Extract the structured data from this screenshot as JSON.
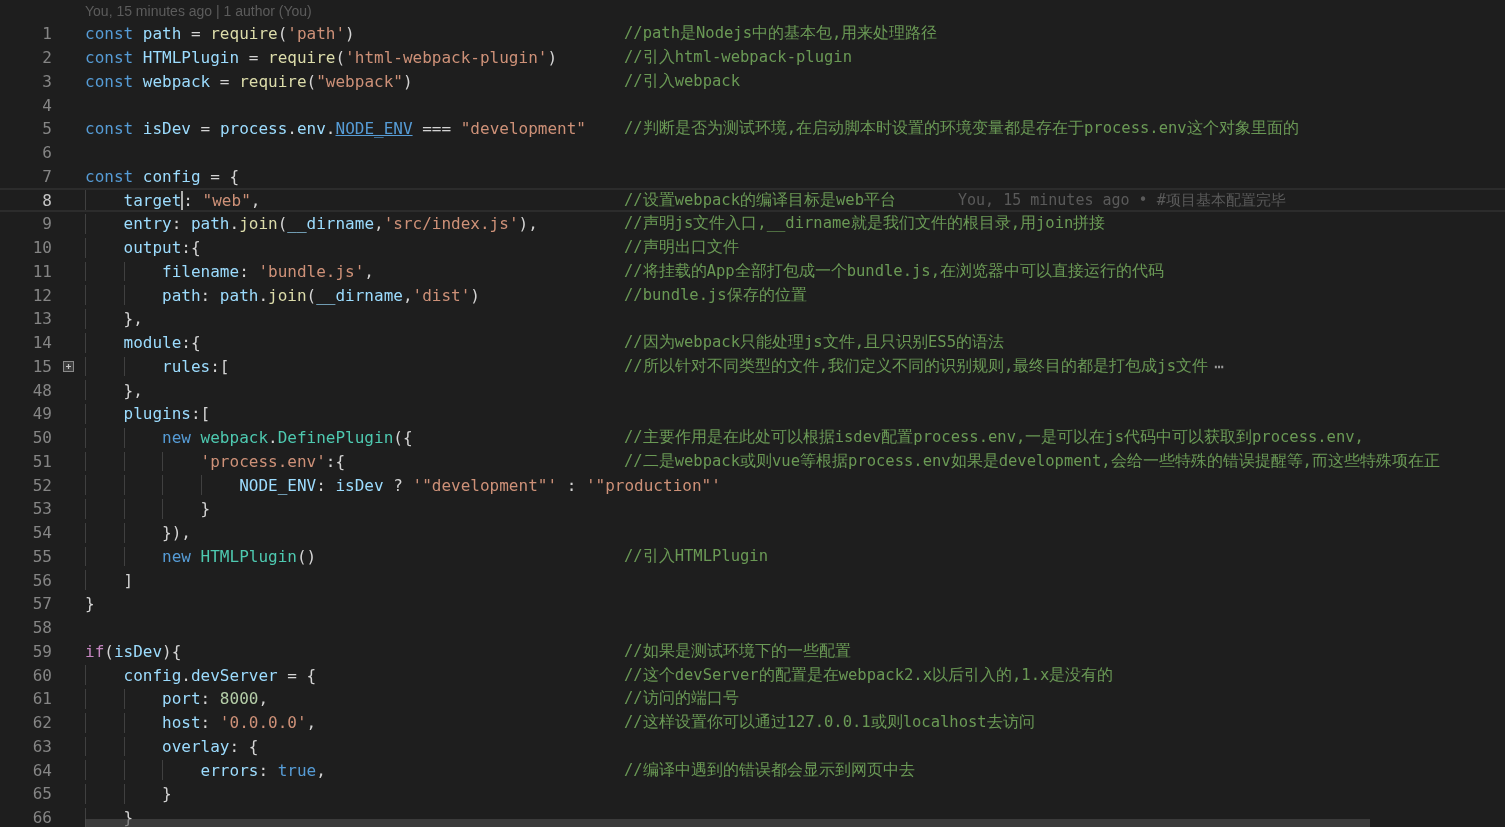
{
  "codelens": "You, 15 minutes ago | 1 author (You)",
  "lines": [
    {
      "number": "1",
      "current": false,
      "folded": false,
      "code": [
        {
          "text": "const ",
          "kind": "keyword"
        },
        {
          "text": "path",
          "kind": "variable"
        },
        {
          "text": " = ",
          "kind": "plain"
        },
        {
          "text": "require",
          "kind": "function"
        },
        {
          "text": "(",
          "kind": "plain"
        },
        {
          "text": "'path'",
          "kind": "string"
        },
        {
          "text": ")",
          "kind": "plain"
        }
      ],
      "comment": "//path是Nodejs中的基本包,用来处理路径"
    },
    {
      "number": "2",
      "current": false,
      "folded": false,
      "code": [
        {
          "text": "const ",
          "kind": "keyword"
        },
        {
          "text": "HTMLPlugin",
          "kind": "variable"
        },
        {
          "text": " = ",
          "kind": "plain"
        },
        {
          "text": "require",
          "kind": "function"
        },
        {
          "text": "(",
          "kind": "plain"
        },
        {
          "text": "'html-webpack-plugin'",
          "kind": "string"
        },
        {
          "text": ")",
          "kind": "plain"
        }
      ],
      "comment": "//引入html-webpack-plugin"
    },
    {
      "number": "3",
      "current": false,
      "folded": false,
      "code": [
        {
          "text": "const ",
          "kind": "keyword"
        },
        {
          "text": "webpack",
          "kind": "variable"
        },
        {
          "text": " = ",
          "kind": "plain"
        },
        {
          "text": "require",
          "kind": "function"
        },
        {
          "text": "(",
          "kind": "plain"
        },
        {
          "text": "\"webpack\"",
          "kind": "string"
        },
        {
          "text": ")",
          "kind": "plain"
        }
      ],
      "comment": "//引入webpack"
    },
    {
      "number": "4",
      "current": false,
      "folded": false
    },
    {
      "number": "5",
      "current": false,
      "folded": false,
      "code": [
        {
          "text": "const ",
          "kind": "keyword"
        },
        {
          "text": "isDev",
          "kind": "variable"
        },
        {
          "text": " = ",
          "kind": "plain"
        },
        {
          "text": "process",
          "kind": "variable"
        },
        {
          "text": ".",
          "kind": "plain"
        },
        {
          "text": "env",
          "kind": "variable"
        },
        {
          "text": ".",
          "kind": "plain"
        },
        {
          "text": "NODE_ENV",
          "kind": "link"
        },
        {
          "text": " === ",
          "kind": "plain"
        },
        {
          "text": "\"development\"",
          "kind": "string"
        }
      ],
      "comment": "//判断是否为测试环境,在启动脚本时设置的环境变量都是存在于process.env这个对象里面的"
    },
    {
      "number": "6",
      "current": false,
      "folded": false
    },
    {
      "number": "7",
      "current": false,
      "folded": false,
      "code": [
        {
          "text": "const ",
          "kind": "keyword"
        },
        {
          "text": "config",
          "kind": "variable"
        },
        {
          "text": " = {",
          "kind": "plain"
        }
      ]
    },
    {
      "number": "8",
      "current": true,
      "folded": false,
      "code": [
        {
          "text": "    target",
          "kind": "variable",
          "cursor": true
        },
        {
          "text": ": ",
          "kind": "plain"
        },
        {
          "text": "\"web\"",
          "kind": "string"
        },
        {
          "text": ",",
          "kind": "plain"
        }
      ],
      "comment": "//设置webpack的编译目标是web平台",
      "blame": "You, 15 minutes ago • #项目基本配置完毕"
    },
    {
      "number": "9",
      "current": false,
      "folded": false,
      "code": [
        {
          "text": "    entry",
          "kind": "variable"
        },
        {
          "text": ": ",
          "kind": "plain"
        },
        {
          "text": "path",
          "kind": "variable"
        },
        {
          "text": ".",
          "kind": "plain"
        },
        {
          "text": "join",
          "kind": "function"
        },
        {
          "text": "(",
          "kind": "plain"
        },
        {
          "text": "__dirname",
          "kind": "variable"
        },
        {
          "text": ",",
          "kind": "plain"
        },
        {
          "text": "'src/index.js'",
          "kind": "string"
        },
        {
          "text": "),",
          "kind": "plain"
        }
      ],
      "comment": "//声明js文件入口,__dirname就是我们文件的根目录,用join拼接"
    },
    {
      "number": "10",
      "current": false,
      "folded": false,
      "code": [
        {
          "text": "    output",
          "kind": "variable"
        },
        {
          "text": ":{",
          "kind": "plain"
        }
      ],
      "comment": "//声明出口文件"
    },
    {
      "number": "11",
      "current": false,
      "folded": false,
      "code": [
        {
          "text": "        filename",
          "kind": "variable"
        },
        {
          "text": ": ",
          "kind": "plain"
        },
        {
          "text": "'bundle.js'",
          "kind": "string"
        },
        {
          "text": ",",
          "kind": "plain"
        }
      ],
      "comment": "//将挂载的App全部打包成一个bundle.js,在浏览器中可以直接运行的代码"
    },
    {
      "number": "12",
      "current": false,
      "folded": false,
      "code": [
        {
          "text": "        path",
          "kind": "variable"
        },
        {
          "text": ": ",
          "kind": "plain"
        },
        {
          "text": "path",
          "kind": "variable"
        },
        {
          "text": ".",
          "kind": "plain"
        },
        {
          "text": "join",
          "kind": "function"
        },
        {
          "text": "(",
          "kind": "plain"
        },
        {
          "text": "__dirname",
          "kind": "variable"
        },
        {
          "text": ",",
          "kind": "plain"
        },
        {
          "text": "'dist'",
          "kind": "string"
        },
        {
          "text": ")",
          "kind": "plain"
        }
      ],
      "comment": "//bundle.js保存的位置"
    },
    {
      "number": "13",
      "current": false,
      "folded": false,
      "code": [
        {
          "text": "    },",
          "kind": "plain"
        }
      ]
    },
    {
      "number": "14",
      "current": false,
      "folded": false,
      "code": [
        {
          "text": "    module",
          "kind": "variable"
        },
        {
          "text": ":{",
          "kind": "plain"
        }
      ],
      "comment": "//因为webpack只能处理js文件,且只识别ES5的语法"
    },
    {
      "number": "15",
      "current": false,
      "folded": true,
      "code": [
        {
          "text": "        rules",
          "kind": "variable"
        },
        {
          "text": ":[",
          "kind": "plain"
        }
      ],
      "comment": "//所以针对不同类型的文件,我们定义不同的识别规则,最终目的都是打包成js文件",
      "fold_ellipsis": "⋯"
    },
    {
      "number": "48",
      "current": false,
      "folded": false,
      "code": [
        {
          "text": "    },",
          "kind": "plain"
        }
      ]
    },
    {
      "number": "49",
      "current": false,
      "folded": false,
      "code": [
        {
          "text": "    plugins",
          "kind": "variable"
        },
        {
          "text": ":[",
          "kind": "plain"
        }
      ]
    },
    {
      "number": "50",
      "current": false,
      "folded": false,
      "code": [
        {
          "text": "        new ",
          "kind": "keyword"
        },
        {
          "text": "webpack",
          "kind": "class"
        },
        {
          "text": ".",
          "kind": "plain"
        },
        {
          "text": "DefinePlugin",
          "kind": "class"
        },
        {
          "text": "({",
          "kind": "plain"
        }
      ],
      "comment": "//主要作用是在此处可以根据isdev配置process.env,一是可以在js代码中可以获取到process.env,"
    },
    {
      "number": "51",
      "current": false,
      "folded": false,
      "code": [
        {
          "text": "            'process.env'",
          "kind": "string"
        },
        {
          "text": ":{",
          "kind": "plain"
        }
      ],
      "comment": "//二是webpack或则vue等根据process.env如果是development,会给一些特殊的错误提醒等,而这些特殊项在正"
    },
    {
      "number": "52",
      "current": false,
      "folded": false,
      "code": [
        {
          "text": "                NODE_ENV",
          "kind": "variable"
        },
        {
          "text": ": ",
          "kind": "plain"
        },
        {
          "text": "isDev",
          "kind": "variable"
        },
        {
          "text": " ? ",
          "kind": "plain"
        },
        {
          "text": "'\"development\"'",
          "kind": "string"
        },
        {
          "text": " : ",
          "kind": "plain"
        },
        {
          "text": "'\"production\"'",
          "kind": "string"
        }
      ]
    },
    {
      "number": "53",
      "current": false,
      "folded": false,
      "code": [
        {
          "text": "            }",
          "kind": "plain"
        }
      ]
    },
    {
      "number": "54",
      "current": false,
      "folded": false,
      "code": [
        {
          "text": "        }),",
          "kind": "plain"
        }
      ]
    },
    {
      "number": "55",
      "current": false,
      "folded": false,
      "code": [
        {
          "text": "        new ",
          "kind": "keyword"
        },
        {
          "text": "HTMLPlugin",
          "kind": "class"
        },
        {
          "text": "()",
          "kind": "plain"
        }
      ],
      "comment": "//引入HTMLPlugin"
    },
    {
      "number": "56",
      "current": false,
      "folded": false,
      "code": [
        {
          "text": "    ]",
          "kind": "plain"
        }
      ]
    },
    {
      "number": "57",
      "current": false,
      "folded": false,
      "code": [
        {
          "text": "}",
          "kind": "plain"
        }
      ]
    },
    {
      "number": "58",
      "current": false,
      "folded": false
    },
    {
      "number": "59",
      "current": false,
      "folded": false,
      "code": [
        {
          "text": "if",
          "kind": "control"
        },
        {
          "text": "(",
          "kind": "plain"
        },
        {
          "text": "isDev",
          "kind": "variable"
        },
        {
          "text": "){",
          "kind": "plain"
        }
      ],
      "comment": "//如果是测试环境下的一些配置"
    },
    {
      "number": "60",
      "current": false,
      "folded": false,
      "code": [
        {
          "text": "    config",
          "kind": "variable"
        },
        {
          "text": ".",
          "kind": "plain"
        },
        {
          "text": "devServer",
          "kind": "variable"
        },
        {
          "text": " = {",
          "kind": "plain"
        }
      ],
      "comment": "//这个devServer的配置是在webpack2.x以后引入的,1.x是没有的"
    },
    {
      "number": "61",
      "current": false,
      "folded": false,
      "code": [
        {
          "text": "        port",
          "kind": "variable"
        },
        {
          "text": ": ",
          "kind": "plain"
        },
        {
          "text": "8000",
          "kind": "number"
        },
        {
          "text": ",",
          "kind": "plain"
        }
      ],
      "comment": "//访问的端口号"
    },
    {
      "number": "62",
      "current": false,
      "folded": false,
      "code": [
        {
          "text": "        host",
          "kind": "variable"
        },
        {
          "text": ": ",
          "kind": "plain"
        },
        {
          "text": "'0.0.0.0'",
          "kind": "string"
        },
        {
          "text": ",",
          "kind": "plain"
        }
      ],
      "comment": "//这样设置你可以通过127.0.0.1或则localhost去访问"
    },
    {
      "number": "63",
      "current": false,
      "folded": false,
      "code": [
        {
          "text": "        overlay",
          "kind": "variable"
        },
        {
          "text": ": {",
          "kind": "plain"
        }
      ]
    },
    {
      "number": "64",
      "current": false,
      "folded": false,
      "code": [
        {
          "text": "            errors",
          "kind": "variable"
        },
        {
          "text": ": ",
          "kind": "plain"
        },
        {
          "text": "true",
          "kind": "keyword"
        },
        {
          "text": ",",
          "kind": "plain"
        }
      ],
      "comment": "//编译中遇到的错误都会显示到网页中去"
    },
    {
      "number": "65",
      "current": false,
      "folded": false,
      "code": [
        {
          "text": "        }",
          "kind": "plain"
        }
      ]
    },
    {
      "number": "66",
      "current": false,
      "folded": false,
      "code": [
        {
          "text": "    }",
          "kind": "plain"
        }
      ]
    }
  ]
}
